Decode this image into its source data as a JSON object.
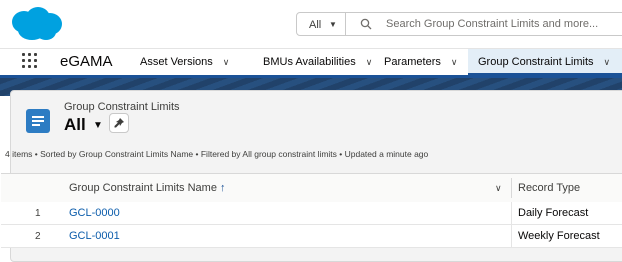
{
  "header": {
    "search_scope": "All",
    "search_placeholder": "Search Group Constraint Limits and more..."
  },
  "nav": {
    "app_name": "eGAMA",
    "tabs": [
      {
        "label": "Asset Versions"
      },
      {
        "label": "BMUs Availabilities"
      },
      {
        "label": "Parameters"
      },
      {
        "label": "Group Constraint Limits"
      }
    ]
  },
  "list": {
    "object_label": "Group Constraint Limits",
    "view_name": "All",
    "info": "4 items • Sorted by Group Constraint Limits Name • Filtered by All group constraint limits • Updated a minute ago",
    "columns": [
      "Group Constraint Limits Name",
      "Record Type"
    ],
    "rows": [
      {
        "num": "1",
        "name": "GCL-0000",
        "type": "Daily Forecast"
      },
      {
        "num": "2",
        "name": "GCL-0001",
        "type": "Weekly Forecast"
      }
    ]
  },
  "colors": {
    "brand": "#1b5297",
    "logo": "#00a1e0",
    "link": "#0b5cab"
  },
  "icons": [
    "salesforce-logo",
    "search-icon",
    "app-launcher-icon",
    "chevron-down-icon",
    "list-icon",
    "pin-icon",
    "sort-up-icon"
  ]
}
